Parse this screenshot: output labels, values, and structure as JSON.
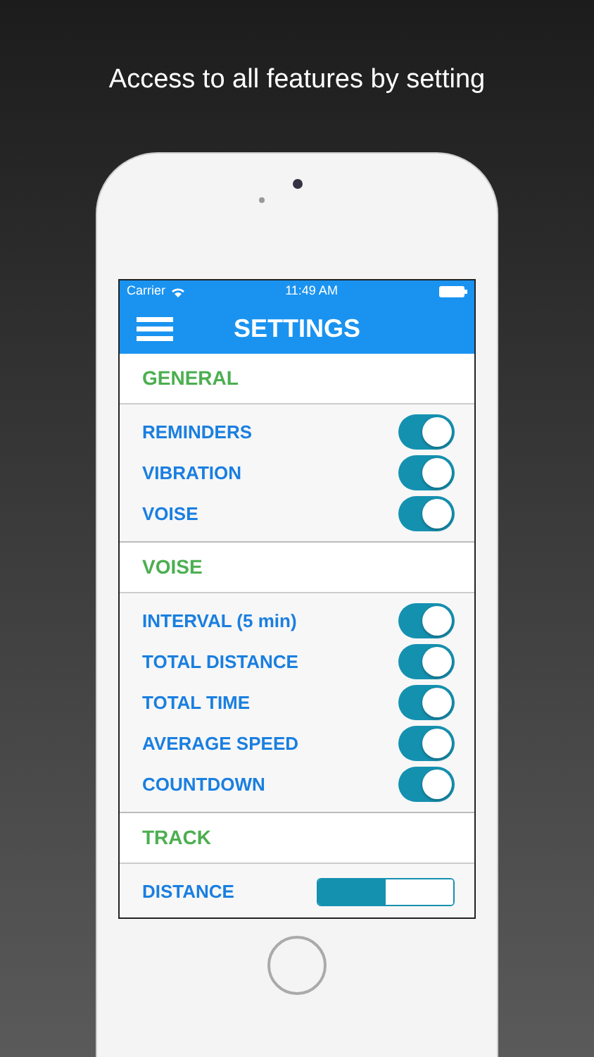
{
  "headline": "Access to all features by setting",
  "status_bar": {
    "carrier": "Carrier",
    "time": "11:49 AM"
  },
  "nav": {
    "title": "SETTINGS"
  },
  "sections": [
    {
      "title": "GENERAL",
      "items": [
        {
          "label": "REMINDERS",
          "kind": "toggle",
          "on": true
        },
        {
          "label": "VIBRATION",
          "kind": "toggle",
          "on": true
        },
        {
          "label": "VOISE",
          "kind": "toggle",
          "on": true
        }
      ]
    },
    {
      "title": "VOISE",
      "items": [
        {
          "label": "INTERVAL (5 min)",
          "kind": "toggle",
          "on": true
        },
        {
          "label": "TOTAL DISTANCE",
          "kind": "toggle",
          "on": true
        },
        {
          "label": "TOTAL TIME",
          "kind": "toggle",
          "on": true
        },
        {
          "label": "AVERAGE SPEED",
          "kind": "toggle",
          "on": true
        },
        {
          "label": "COUNTDOWN",
          "kind": "toggle",
          "on": true
        }
      ]
    },
    {
      "title": "TRACK",
      "items": [
        {
          "label": "DISTANCE",
          "kind": "segmented",
          "segments": [
            {
              "selected": true
            },
            {
              "selected": false
            }
          ]
        }
      ]
    }
  ]
}
